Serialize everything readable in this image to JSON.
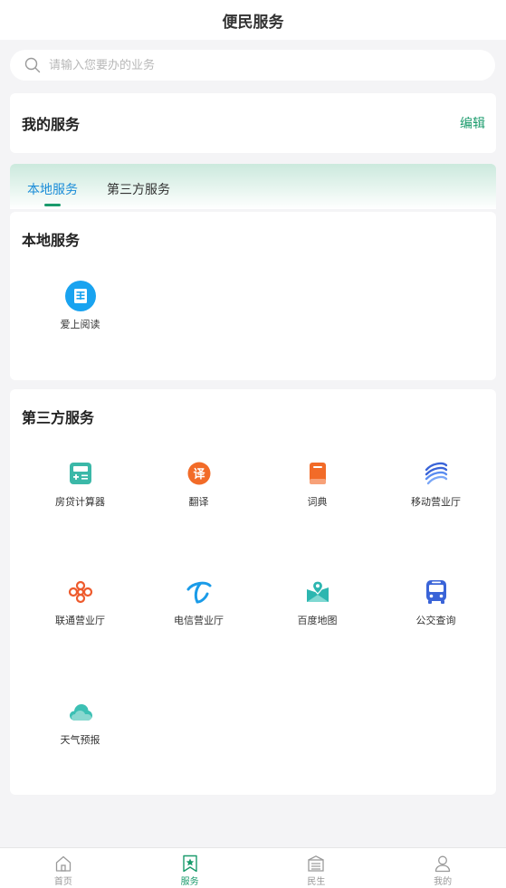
{
  "header": {
    "title": "便民服务"
  },
  "search": {
    "placeholder": "请输入您要办的业务",
    "value": ""
  },
  "my_service": {
    "title": "我的服务",
    "edit_label": "编辑"
  },
  "tabs": [
    {
      "label": "本地服务",
      "active": true
    },
    {
      "label": "第三方服务",
      "active": false
    }
  ],
  "local_services": {
    "title": "本地服务",
    "items": [
      {
        "label": "爱上阅读",
        "icon": "book-reader-icon",
        "color": "#19a3f0"
      }
    ]
  },
  "third_party_services": {
    "title": "第三方服务",
    "items": [
      {
        "label": "房贷计算器",
        "icon": "calculator-icon",
        "color": "#3bb8a8"
      },
      {
        "label": "翻译",
        "icon": "translate-icon",
        "color": "#f26b28"
      },
      {
        "label": "词典",
        "icon": "dictionary-icon",
        "color": "#f26b28"
      },
      {
        "label": "移动营业厅",
        "icon": "china-mobile-icon",
        "color": "#3a64d8"
      },
      {
        "label": "联通营业厅",
        "icon": "china-unicom-icon",
        "color": "#ee5a2c"
      },
      {
        "label": "电信营业厅",
        "icon": "china-telecom-icon",
        "color": "#1a9be8"
      },
      {
        "label": "百度地图",
        "icon": "map-icon",
        "color": "#2cb6b0"
      },
      {
        "label": "公交查询",
        "icon": "bus-icon",
        "color": "#3a64d8"
      },
      {
        "label": "天气预报",
        "icon": "weather-cloud-icon",
        "color": "#3cc0b4"
      }
    ]
  },
  "tabbar": [
    {
      "label": "首页",
      "icon": "home-icon",
      "active": false
    },
    {
      "label": "服务",
      "icon": "bookmark-star-icon",
      "active": true
    },
    {
      "label": "民生",
      "icon": "list-building-icon",
      "active": false
    },
    {
      "label": "我的",
      "icon": "user-icon",
      "active": false
    }
  ],
  "colors": {
    "accent": "#1a9b6c",
    "tab_active_text": "#1a8cd8",
    "background": "#f4f4f6"
  }
}
